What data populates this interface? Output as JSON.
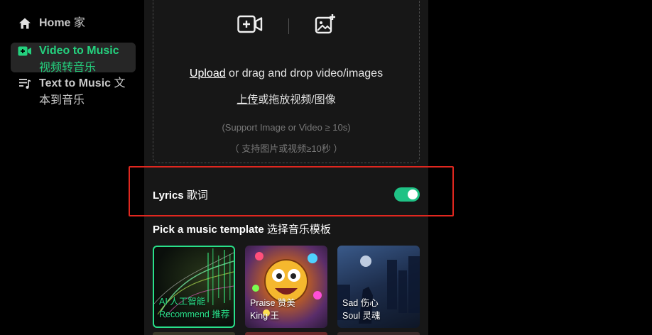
{
  "sidebar": {
    "items": [
      {
        "label_en": "Home",
        "label_cn": " 家",
        "icon": "home-icon",
        "active": false
      },
      {
        "label_en": "Video to Music",
        "label_cn": " 视频转音乐",
        "icon": "video-plus-icon",
        "active": true
      },
      {
        "label_en": "Text to Music",
        "label_cn": " 文本到音乐",
        "icon": "text-music-icon",
        "active": false
      }
    ]
  },
  "upload": {
    "link": "Upload",
    "text": " or drag and drop video/images",
    "link_cn": "上传",
    "text_cn": "或拖放视频/图像",
    "note": "(Support Image or Video ≥ 10s)",
    "note_cn": "（ 支持图片或视频≥10秒 ）",
    "icons": [
      "video-add-icon",
      "image-add-icon"
    ]
  },
  "lyrics": {
    "label_en": "Lyrics",
    "label_cn": " 歌词",
    "enabled": true
  },
  "templates": {
    "title_en": "Pick a music template",
    "title_cn": " 选择音乐模板",
    "cards": [
      {
        "line1": "AI 人工智能",
        "line2": "Recommend 推荐",
        "selected": true
      },
      {
        "line1": "Praise 赞美",
        "line2": "King 王",
        "selected": false
      },
      {
        "line1": "Sad 伤心",
        "line2": "Soul 灵魂",
        "selected": false
      }
    ]
  },
  "colors": {
    "accent": "#24d17e",
    "highlight": "#e0271f",
    "panel": "#171717",
    "toggle": "#1fc285"
  }
}
